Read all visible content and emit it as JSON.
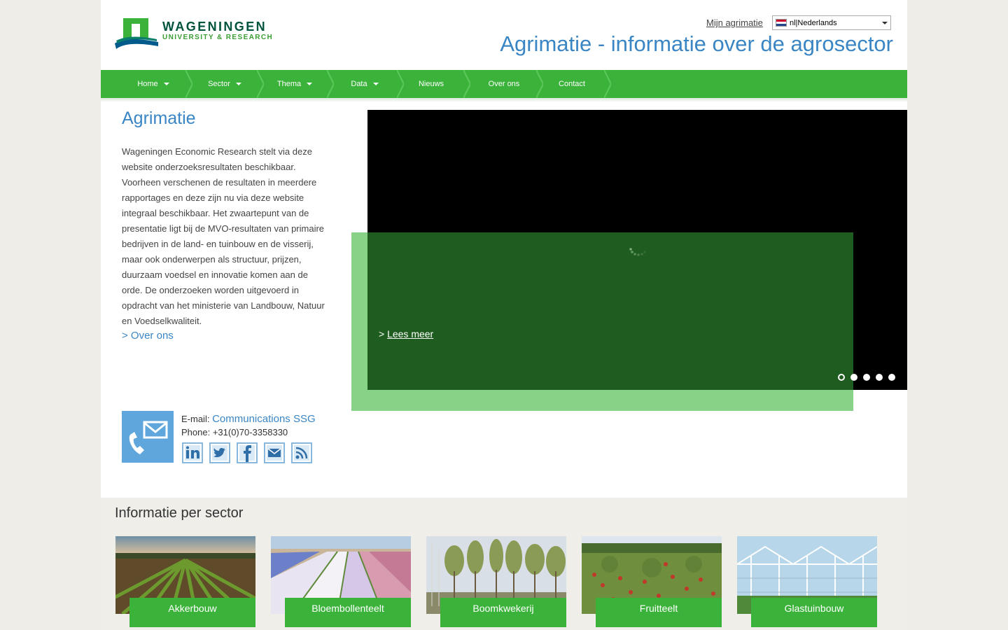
{
  "header": {
    "logo_title": "WAGENINGEN",
    "logo_subtitle": "UNIVERSITY & RESEARCH",
    "mijn_link": "Mijn agrimatie",
    "language": "nl|Nederlands",
    "site_title": "Agrimatie - informatie over de agrosector"
  },
  "nav": {
    "items": [
      {
        "label": "Home",
        "has_dropdown": true
      },
      {
        "label": "Sector",
        "has_dropdown": true
      },
      {
        "label": "Thema",
        "has_dropdown": true
      },
      {
        "label": "Data",
        "has_dropdown": true
      },
      {
        "label": "Nieuws",
        "has_dropdown": false
      },
      {
        "label": "Over ons",
        "has_dropdown": false
      },
      {
        "label": "Contact",
        "has_dropdown": false
      }
    ]
  },
  "intro": {
    "title": "Agrimatie",
    "text": "Wageningen Economic Research stelt via deze website onderzoeksresultaten beschikbaar. Voorheen verschenen de resultaten in meerdere rapportages en deze zijn nu via deze website integraal beschikbaar. Het zwaartepunt van de presentatie ligt bij de MVO-resultaten van primaire bedrijven in de land- en tuinbouw en de visserij, maar ook onderwerpen als structuur, prijzen, duurzaam voedsel en innovatie komen aan de orde. De onderzoeken worden uitgevoerd in opdracht van het ministerie van Landbouw, Natuur en Voedselkwaliteit.",
    "link": "> Over ons"
  },
  "contact": {
    "email_label": "E-mail:",
    "email_link": "Communications SSG",
    "phone": "Phone: +31(0)70-3358330",
    "social": [
      "linkedin-icon",
      "twitter-icon",
      "facebook-icon",
      "mail-icon",
      "rss-icon"
    ]
  },
  "slider": {
    "prefix": ">",
    "link": "Lees meer",
    "dot_count": 5,
    "active_dot": 0
  },
  "sectors": {
    "heading": "Informatie per sector",
    "items": [
      {
        "label": "Akkerbouw"
      },
      {
        "label": "Bloembollenteelt"
      },
      {
        "label": "Boomkwekerij"
      },
      {
        "label": "Fruitteelt"
      },
      {
        "label": "Glastuinbouw"
      }
    ]
  },
  "colors": {
    "nav_green": "#3bb33b",
    "title_blue": "#3a86c5",
    "slider_dark_green": "#1f5c1f",
    "slider_light_green": "#87d287"
  }
}
